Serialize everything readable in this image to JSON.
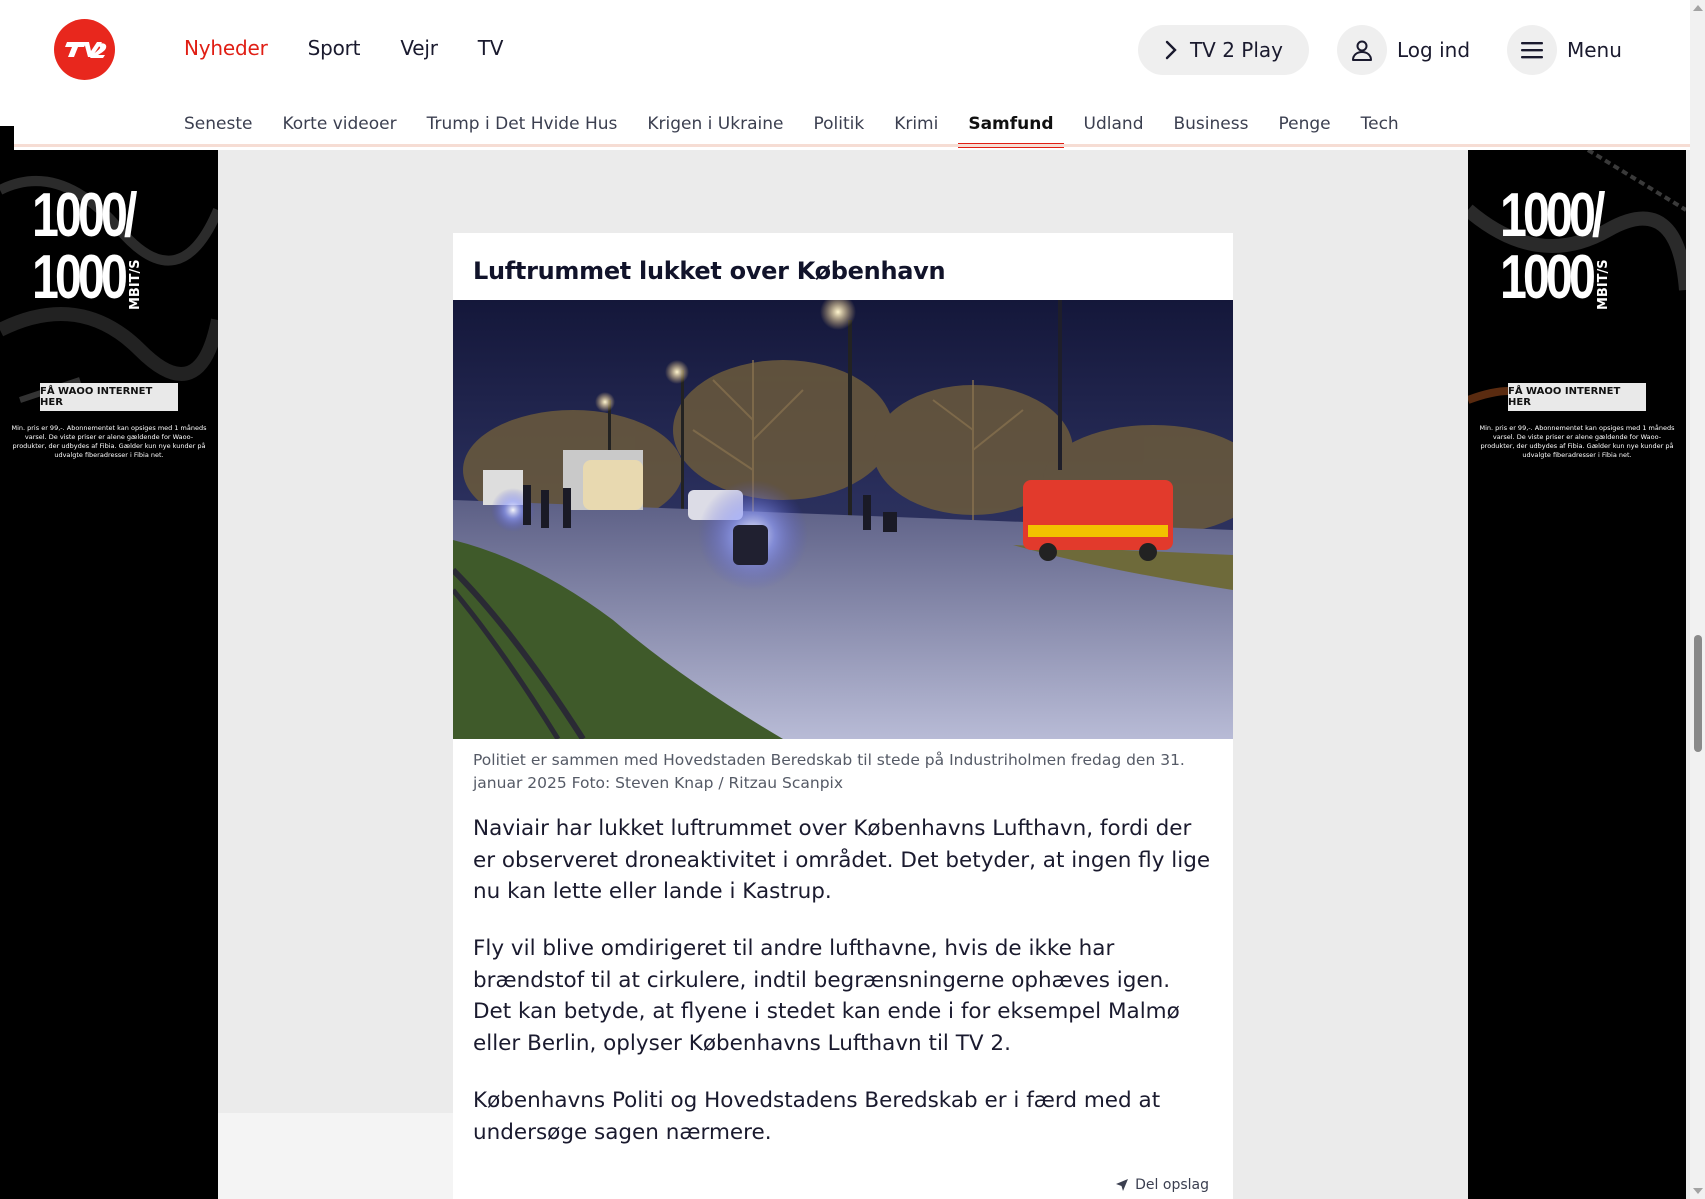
{
  "header": {
    "logo_text": "TV2",
    "nav": [
      {
        "label": "Nyheder",
        "active": true
      },
      {
        "label": "Sport",
        "active": false
      },
      {
        "label": "Vejr",
        "active": false
      },
      {
        "label": "TV",
        "active": false
      }
    ],
    "play_label": "TV 2 Play",
    "login_label": "Log ind",
    "menu_label": "Menu",
    "accent": "#e01e14"
  },
  "subnav": [
    {
      "label": "Seneste",
      "active": false
    },
    {
      "label": "Korte videoer",
      "active": false
    },
    {
      "label": "Trump i Det Hvide Hus",
      "active": false
    },
    {
      "label": "Krigen i Ukraine",
      "active": false
    },
    {
      "label": "Politik",
      "active": false
    },
    {
      "label": "Krimi",
      "active": false
    },
    {
      "label": "Samfund",
      "active": true
    },
    {
      "label": "Udland",
      "active": false
    },
    {
      "label": "Business",
      "active": false
    },
    {
      "label": "Penge",
      "active": false
    },
    {
      "label": "Tech",
      "active": false
    }
  ],
  "ad": {
    "line1": "1000/",
    "line2": "1000",
    "unit": "MBIT/S",
    "cta": "FÅ WAOO INTERNET HER",
    "fineprint": "Min. pris er 99,-. Abonnementet kan opsiges med 1 måneds varsel. De viste priser er alene gældende for Waoo-produkter, der udbydes af Fibia. Gælder kun nye kunder på udvalgte fiberadresser i Fibia net."
  },
  "article": {
    "headline": "Luftrummet lukket over København",
    "image_caption": "Politiet er sammen med Hovedstaden Beredskab til stede på Industriholmen fredag den 31. januar 2025 Foto: Steven Knap / Ritzau Scanpix",
    "paragraphs": [
      "Naviair har lukket luftrummet over Københavns Lufthavn, fordi der er observeret droneaktivitet i området. Det betyder, at ingen fly lige nu kan lette eller lande i Kastrup.",
      "Fly vil blive omdirigeret til andre lufthavne, hvis de ikke har brændstof til at cirkulere, indtil begrænsningerne ophæves igen. Det kan betyde, at flyene i stedet kan ende i for eksempel Malmø eller Berlin, oplyser Københavns Lufthavn til TV 2.",
      "Københavns Politi og Hovedstadens Beredskab er i færd med at undersøge sagen nærmere."
    ],
    "share_label": "Del opslag"
  }
}
